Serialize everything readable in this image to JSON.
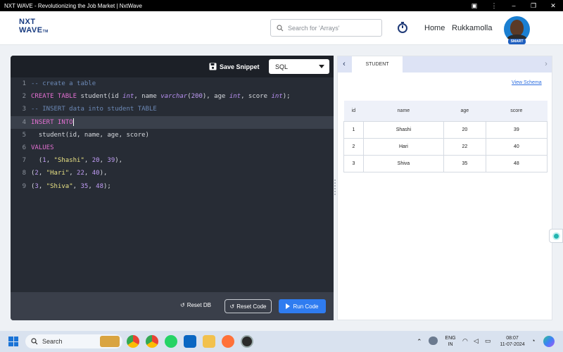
{
  "window": {
    "title": "NXT WAVE - Revolutionizing the Job Market | NxtWave"
  },
  "header": {
    "logo_line1": "NXT",
    "logo_line2": "WAVE",
    "logo_tm": "TM",
    "search_placeholder": "Search for 'Arrays'",
    "nav_home": "Home",
    "user_name": "Rukkamolla",
    "avatar_badge": "SMART"
  },
  "editor": {
    "save_label": "Save Snippet",
    "language": "SQL",
    "line_numbers": [
      "1",
      "2",
      "3",
      "4",
      "5",
      "6",
      "7",
      "8",
      "9"
    ],
    "reset_db_label": "Reset DB",
    "reset_code_label": "Reset Code",
    "run_code_label": "Run Code"
  },
  "panel": {
    "tab_label": "STUDENT",
    "view_schema": "View Schema",
    "columns": [
      "id",
      "name",
      "age",
      "score"
    ],
    "rows": [
      [
        "1",
        "Shashi",
        "20",
        "39"
      ],
      [
        "2",
        "Hari",
        "22",
        "40"
      ],
      [
        "3",
        "Shiva",
        "35",
        "48"
      ]
    ]
  },
  "taskbar": {
    "search_placeholder": "Search",
    "lang_line1": "ENG",
    "lang_line2": "IN",
    "time": "08:07",
    "date": "11-07-2024"
  },
  "colors": {
    "accent": "#2f7cf0",
    "editor_bg": "#272c35",
    "keyword": "#e26fd1",
    "string": "#e7e083"
  }
}
